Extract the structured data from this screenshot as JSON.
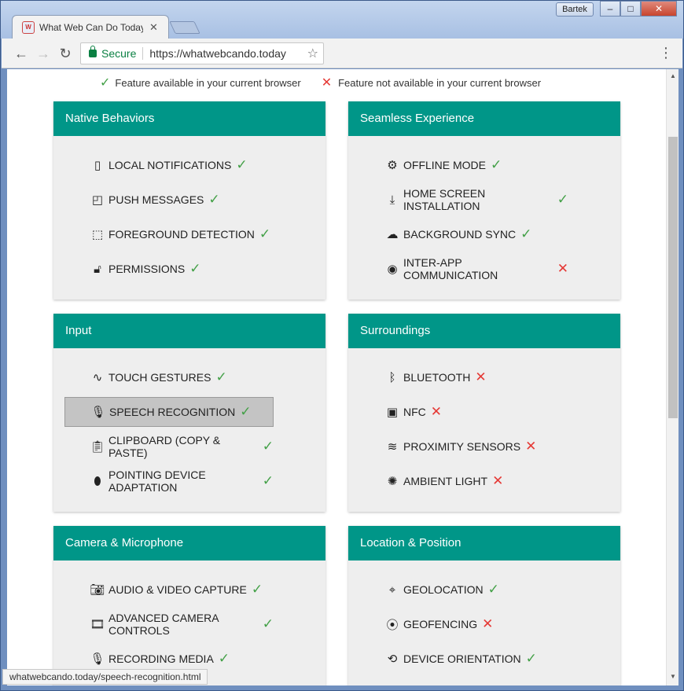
{
  "window": {
    "tab_title": "What Web Can Do Today",
    "user_label": "Bartek",
    "minimize": "–",
    "maximize": "□",
    "close": "✕"
  },
  "toolbar": {
    "secure_label": "Secure",
    "url": "https://whatwebcando.today"
  },
  "legend": {
    "available": "Feature available in your current browser",
    "not_available": "Feature not available in your current browser"
  },
  "sections": [
    {
      "title": "Native Behaviors",
      "features": [
        {
          "label": "LOCAL NOTIFICATIONS",
          "status": "✓",
          "icon": "phone-download-icon"
        },
        {
          "label": "PUSH MESSAGES",
          "status": "✓",
          "icon": "cast-icon"
        },
        {
          "label": "FOREGROUND DETECTION",
          "status": "✓",
          "icon": "window-select-icon"
        },
        {
          "label": "PERMISSIONS",
          "status": "✓",
          "icon": "lock-open-icon"
        }
      ]
    },
    {
      "title": "Seamless Experience",
      "features": [
        {
          "label": "OFFLINE MODE",
          "status": "✓",
          "icon": "gear-box-icon"
        },
        {
          "label": "HOME SCREEN INSTALLATION",
          "status": "✓",
          "icon": "download-icon"
        },
        {
          "label": "BACKGROUND SYNC",
          "status": "✓",
          "icon": "cloud-upload-icon"
        },
        {
          "label": "INTER-APP COMMUNICATION",
          "status": "✕",
          "icon": "compass-icon"
        }
      ]
    },
    {
      "title": "Input",
      "features": [
        {
          "label": "TOUCH GESTURES",
          "status": "✓",
          "icon": "gesture-icon"
        },
        {
          "label": "SPEECH RECOGNITION",
          "status": "✓",
          "icon": "microphone-icon"
        },
        {
          "label": "CLIPBOARD (COPY & PASTE)",
          "status": "✓",
          "icon": "clipboard-icon"
        },
        {
          "label": "POINTING DEVICE ADAPTATION",
          "status": "✓",
          "icon": "mouse-icon"
        }
      ]
    },
    {
      "title": "Surroundings",
      "features": [
        {
          "label": "BLUETOOTH",
          "status": "✕",
          "icon": "bluetooth-icon"
        },
        {
          "label": "NFC",
          "status": "✕",
          "icon": "nfc-icon"
        },
        {
          "label": "PROXIMITY SENSORS",
          "status": "✕",
          "icon": "proximity-icon"
        },
        {
          "label": "AMBIENT LIGHT",
          "status": "✕",
          "icon": "brightness-icon"
        }
      ]
    },
    {
      "title": "Camera & Microphone",
      "features": [
        {
          "label": "AUDIO & VIDEO CAPTURE",
          "status": "✓",
          "icon": "camera-icon"
        },
        {
          "label": "ADVANCED CAMERA CONTROLS",
          "status": "✓",
          "icon": "film-icon"
        },
        {
          "label": "RECORDING MEDIA",
          "status": "✓",
          "icon": "microphone-icon"
        }
      ]
    },
    {
      "title": "Location & Position",
      "features": [
        {
          "label": "GEOLOCATION",
          "status": "✓",
          "icon": "crosshair-icon"
        },
        {
          "label": "GEOFENCING",
          "status": "✕",
          "icon": "geofence-icon"
        },
        {
          "label": "DEVICE ORIENTATION",
          "status": "✓",
          "icon": "rotate-icon"
        }
      ]
    }
  ],
  "status_bar": {
    "url": "whatwebcando.today/speech-recognition.html"
  },
  "colors": {
    "header": "#009688",
    "available": "#43a047",
    "not_available": "#e53935"
  }
}
